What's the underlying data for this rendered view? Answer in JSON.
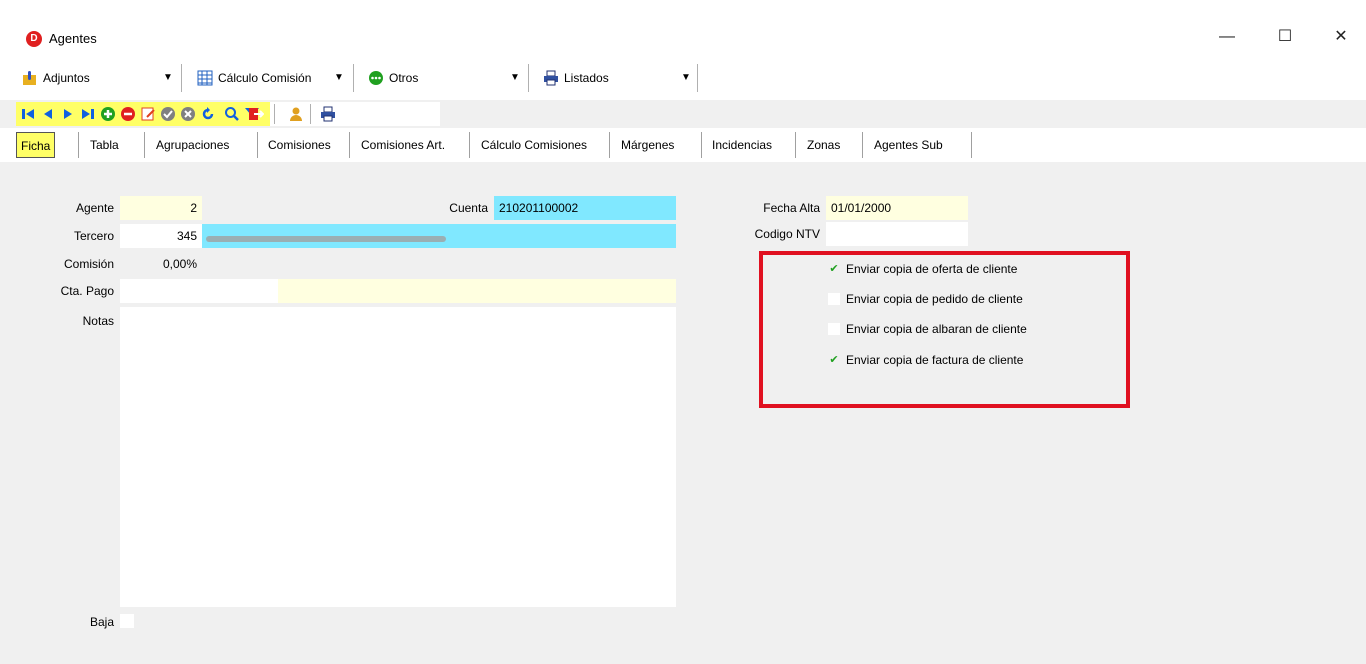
{
  "window": {
    "title": "Agentes",
    "app_icon_letter": "D",
    "minimize": "—",
    "maximize": "☐",
    "close": "✕"
  },
  "menu": {
    "adjuntos": "Adjuntos",
    "calculo_comision": "Cálculo Comisión",
    "otros": "Otros",
    "listados": "Listados",
    "dropdown_arrow": "▼"
  },
  "nav_icons": [
    "first-record-icon",
    "prev-record-icon",
    "next-record-icon",
    "last-record-icon",
    "add-record-icon",
    "delete-record-icon",
    "edit-record-icon",
    "confirm-icon",
    "cancel-icon",
    "refresh-icon",
    "search-icon",
    "filter-icon",
    "exit-icon",
    "user-icon",
    "print-icon"
  ],
  "tabs": [
    "Ficha",
    "Tabla",
    "Agrupaciones",
    "Comisiones",
    "Comisiones Art.",
    "Cálculo Comisiones",
    "Márgenes",
    "Incidencias",
    "Zonas",
    "Agentes Sub"
  ],
  "form": {
    "agente_label": "Agente",
    "agente_value": "2",
    "cuenta_label": "Cuenta",
    "cuenta_value": "210201100002",
    "tercero_label": "Tercero",
    "tercero_value": "345",
    "comision_label": "Comisión",
    "comision_value": "0,00%",
    "cta_pago_label": "Cta. Pago",
    "notas_label": "Notas",
    "baja_label": "Baja",
    "fecha_alta_label": "Fecha Alta",
    "fecha_alta_value": "01/01/2000",
    "codigo_ntv_label": "Codigo NTV"
  },
  "checks": [
    {
      "label": "Enviar copia de oferta de cliente",
      "checked": true
    },
    {
      "label": "Enviar copia de pedido de cliente",
      "checked": false
    },
    {
      "label": "Enviar copia de albaran de cliente",
      "checked": false
    },
    {
      "label": "Enviar copia de factura de cliente",
      "checked": true
    }
  ],
  "colors": {
    "nav_highlight": "#ffff66",
    "cyan_field": "#80e8ff",
    "yellow_field": "#ffffe0",
    "annotation_red": "#e01020"
  }
}
